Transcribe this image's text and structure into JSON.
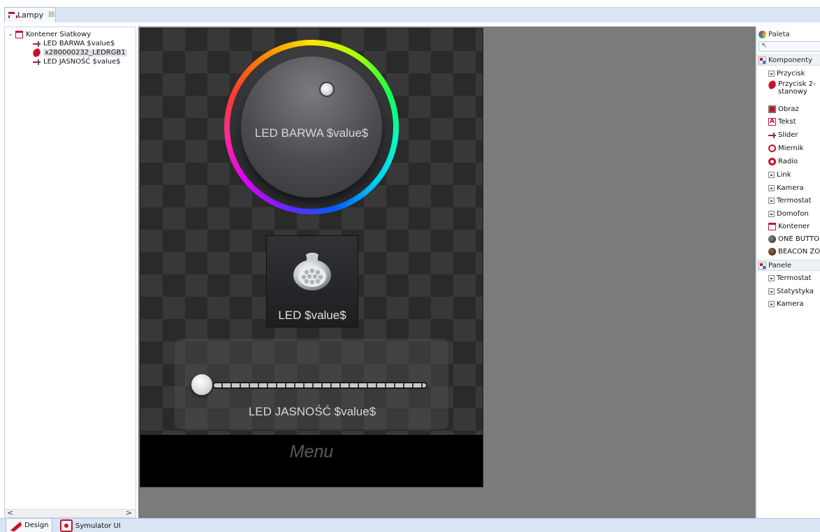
{
  "editor": {
    "tab_label": "Lampy",
    "tab_close": "☒"
  },
  "tree": {
    "root": {
      "label": "Kontener Siatkowy",
      "expanded": true
    },
    "items": [
      {
        "label": "LED BARWA $value$",
        "icon": "slider-icon"
      },
      {
        "label": "x280000232_LEDRGB1",
        "icon": "two-state-button-icon",
        "selected": true
      },
      {
        "label": "LED JASNOŚĆ $value$",
        "icon": "slider-icon"
      }
    ],
    "scroll_left": "<",
    "scroll_right": ">"
  },
  "design": {
    "dial_label": "LED BARWA $value$",
    "button_label": "LED $value$",
    "slider_label": "LED JASNOŚĆ $value$",
    "slider_level": 0.0,
    "menu_label": "Menu"
  },
  "palette": {
    "title": "Paleta",
    "groups": [
      {
        "label": "Komponenty",
        "items": [
          {
            "label": "Przycisk",
            "icon": "small-component-icon"
          },
          {
            "label": "Przycisk 2-stanowy",
            "icon": "flame-icon"
          },
          {
            "label": "Obraz",
            "icon": "image-icon"
          },
          {
            "label": "Tekst",
            "icon": "text-icon"
          },
          {
            "label": "Slider",
            "icon": "slider-icon"
          },
          {
            "label": "Miernik",
            "icon": "meter-icon"
          },
          {
            "label": "Radio",
            "icon": "radio-icon"
          },
          {
            "label": "Link",
            "icon": "small-component-icon"
          },
          {
            "label": "Kamera",
            "icon": "small-component-icon"
          },
          {
            "label": "Termostat",
            "icon": "small-component-icon"
          },
          {
            "label": "Domofon",
            "icon": "small-component-icon"
          },
          {
            "label": "Kontener",
            "icon": "container-icon"
          },
          {
            "label": "ONE BUTTON",
            "icon": "one-button-icon"
          },
          {
            "label": "BEACON ZONE",
            "icon": "beacon-icon"
          }
        ]
      },
      {
        "label": "Panele",
        "items": [
          {
            "label": "Termostat",
            "icon": "small-component-icon"
          },
          {
            "label": "Statystyka",
            "icon": "small-component-icon"
          },
          {
            "label": "Kamera",
            "icon": "small-component-icon"
          }
        ]
      }
    ]
  },
  "bottom_tabs": [
    {
      "label": "Design",
      "active": true
    },
    {
      "label": "Symulator UI",
      "active": false
    }
  ],
  "colors": {
    "accent": "#c8102e",
    "canvas_bg": "#7b7b7b",
    "tab_strip": "#dae5f3"
  }
}
